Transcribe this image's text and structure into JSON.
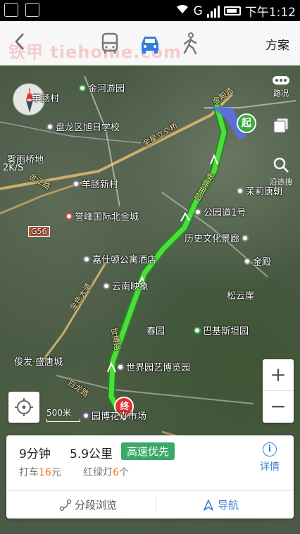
{
  "status_bar": {
    "time": "下午1:12",
    "network": "G"
  },
  "watermark": "铁甲 tiehome.com",
  "top_bar": {
    "plan_label": "方案",
    "modes": [
      "bus-icon",
      "car-icon",
      "walk-icon"
    ],
    "active_mode": "car"
  },
  "map": {
    "speed": "2K/S",
    "scale_label": "500米",
    "road_conditions_label": "路况",
    "start_marker": "起",
    "end_marker": "终",
    "nav_label": "沿途搜",
    "places": [
      {
        "name": "金河游园",
        "style": "green"
      },
      {
        "name": "羊肠村",
        "style": "white"
      },
      {
        "name": "盘龙区旭日学校",
        "style": "white"
      },
      {
        "name": "雾雨桥地",
        "style": "white"
      },
      {
        "name": "羊肠新村",
        "style": "white"
      },
      {
        "name": "誉峰国际北金城",
        "style": "red"
      },
      {
        "name": "嘉仕顿公寓酒店",
        "style": "white"
      },
      {
        "name": "云南映象",
        "style": "white"
      },
      {
        "name": "茉莉唐朝",
        "style": "white"
      },
      {
        "name": "公园道1号",
        "style": "white"
      },
      {
        "name": "历史文化景廊",
        "style": "white"
      },
      {
        "name": "金殿",
        "style": "white"
      },
      {
        "name": "松云崖",
        "style": "white"
      },
      {
        "name": "春园",
        "style": "white"
      },
      {
        "name": "巴基斯坦园",
        "style": "green"
      },
      {
        "name": "世界园艺博览园",
        "style": "white"
      },
      {
        "name": "俊发·盛唐城",
        "style": "white"
      },
      {
        "name": "园博花卉市场",
        "style": "purple"
      }
    ],
    "roads": [
      "金江路",
      "金星立交桥",
      "G56",
      "世博路",
      "金色大道",
      "白龙路",
      "昆曲高速",
      "金殿路"
    ]
  },
  "route_panel": {
    "duration": "9分钟",
    "distance": "5.9公里",
    "preference_tag": "高速优先",
    "taxi_prefix": "打车",
    "taxi_fare": "16",
    "taxi_suffix": "元",
    "lights_prefix": "红绿灯",
    "lights_count": "6",
    "lights_suffix": "个",
    "detail_label": "详情",
    "segment_browse_label": "分段浏览",
    "navigate_label": "导航"
  }
}
